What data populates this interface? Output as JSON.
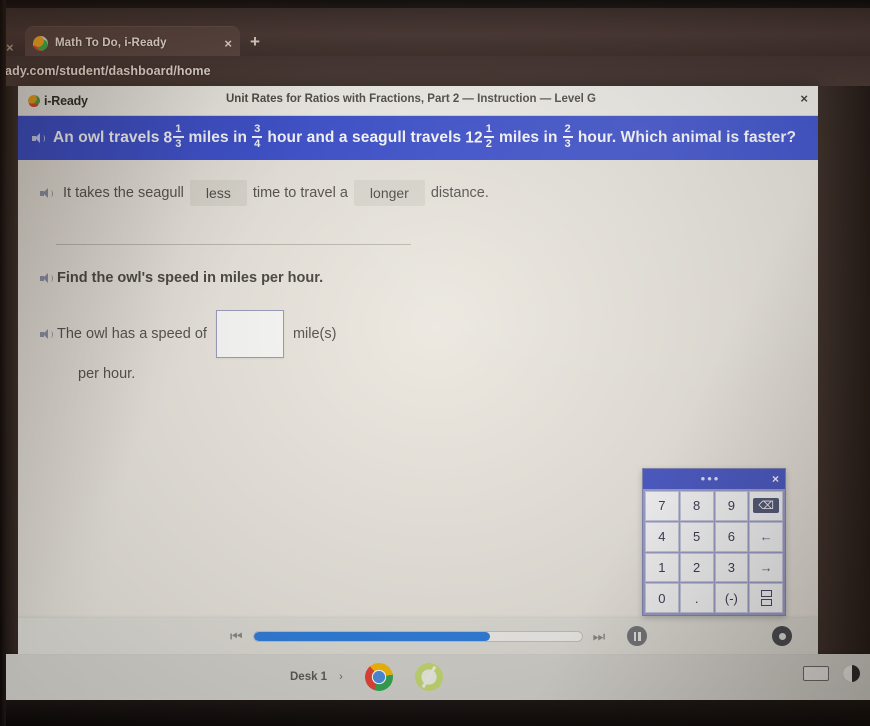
{
  "browser": {
    "tab": {
      "title": "Math To Do, i-Ready",
      "close_label": "×",
      "favicon_name": "iready-favicon"
    },
    "new_tab_label": "+",
    "ghost_close_label": "×",
    "url": "eady.com/student/dashboard/home"
  },
  "lesson": {
    "brand": "i-Ready",
    "title": "Unit Rates for Ratios with Fractions, Part 2 — Instruction — Level G",
    "close_label": "×"
  },
  "question": {
    "p1": "An owl travels",
    "mixed1_whole": "8",
    "mixed1_num": "1",
    "mixed1_den": "3",
    "p2": "miles in",
    "frac1_num": "3",
    "frac1_den": "4",
    "p3": "hour and a seagull travels",
    "mixed2_whole": "12",
    "mixed2_num": "1",
    "mixed2_den": "2",
    "p4": "miles in",
    "frac2_num": "2",
    "frac2_den": "3",
    "p5": "hour. Which animal is faster?"
  },
  "worksheet": {
    "sentence_part1": "It takes the seagull",
    "dropdown1_value": "less",
    "sentence_part2": "time to travel a",
    "dropdown2_value": "longer",
    "sentence_part3": "distance.",
    "find_prompt": "Find the owl's speed in miles per hour.",
    "answer_prefix": "The owl has a speed of",
    "answer_value": "",
    "answer_unit": "mile(s)",
    "answer_suffix": "per hour."
  },
  "keypad": {
    "drag_handle": "•••",
    "close_label": "×",
    "keys": [
      {
        "label": "7",
        "name": "key-7"
      },
      {
        "label": "8",
        "name": "key-8"
      },
      {
        "label": "9",
        "name": "key-9"
      },
      {
        "label": "⌫",
        "name": "key-backspace"
      },
      {
        "label": "4",
        "name": "key-4"
      },
      {
        "label": "5",
        "name": "key-5"
      },
      {
        "label": "6",
        "name": "key-6"
      },
      {
        "label": "←",
        "name": "key-cursor-left"
      },
      {
        "label": "1",
        "name": "key-1"
      },
      {
        "label": "2",
        "name": "key-2"
      },
      {
        "label": "3",
        "name": "key-3"
      },
      {
        "label": "→",
        "name": "key-cursor-right"
      },
      {
        "label": "0",
        "name": "key-0"
      },
      {
        "label": ".",
        "name": "key-decimal"
      },
      {
        "label": "(-)",
        "name": "key-negative"
      },
      {
        "label": "",
        "name": "key-fraction"
      }
    ]
  },
  "player": {
    "prev_label": "⏮",
    "next_label": "⏭",
    "progress_percent": 72
  },
  "shelf": {
    "desk_label": "Desk 1",
    "desk_chevron": "›"
  },
  "colors": {
    "question_banner": "#3b4fd0",
    "progress_fill": "#2e7fe0",
    "keypad_header": "#4b5ac8",
    "page_bg": "#ece8e0"
  }
}
